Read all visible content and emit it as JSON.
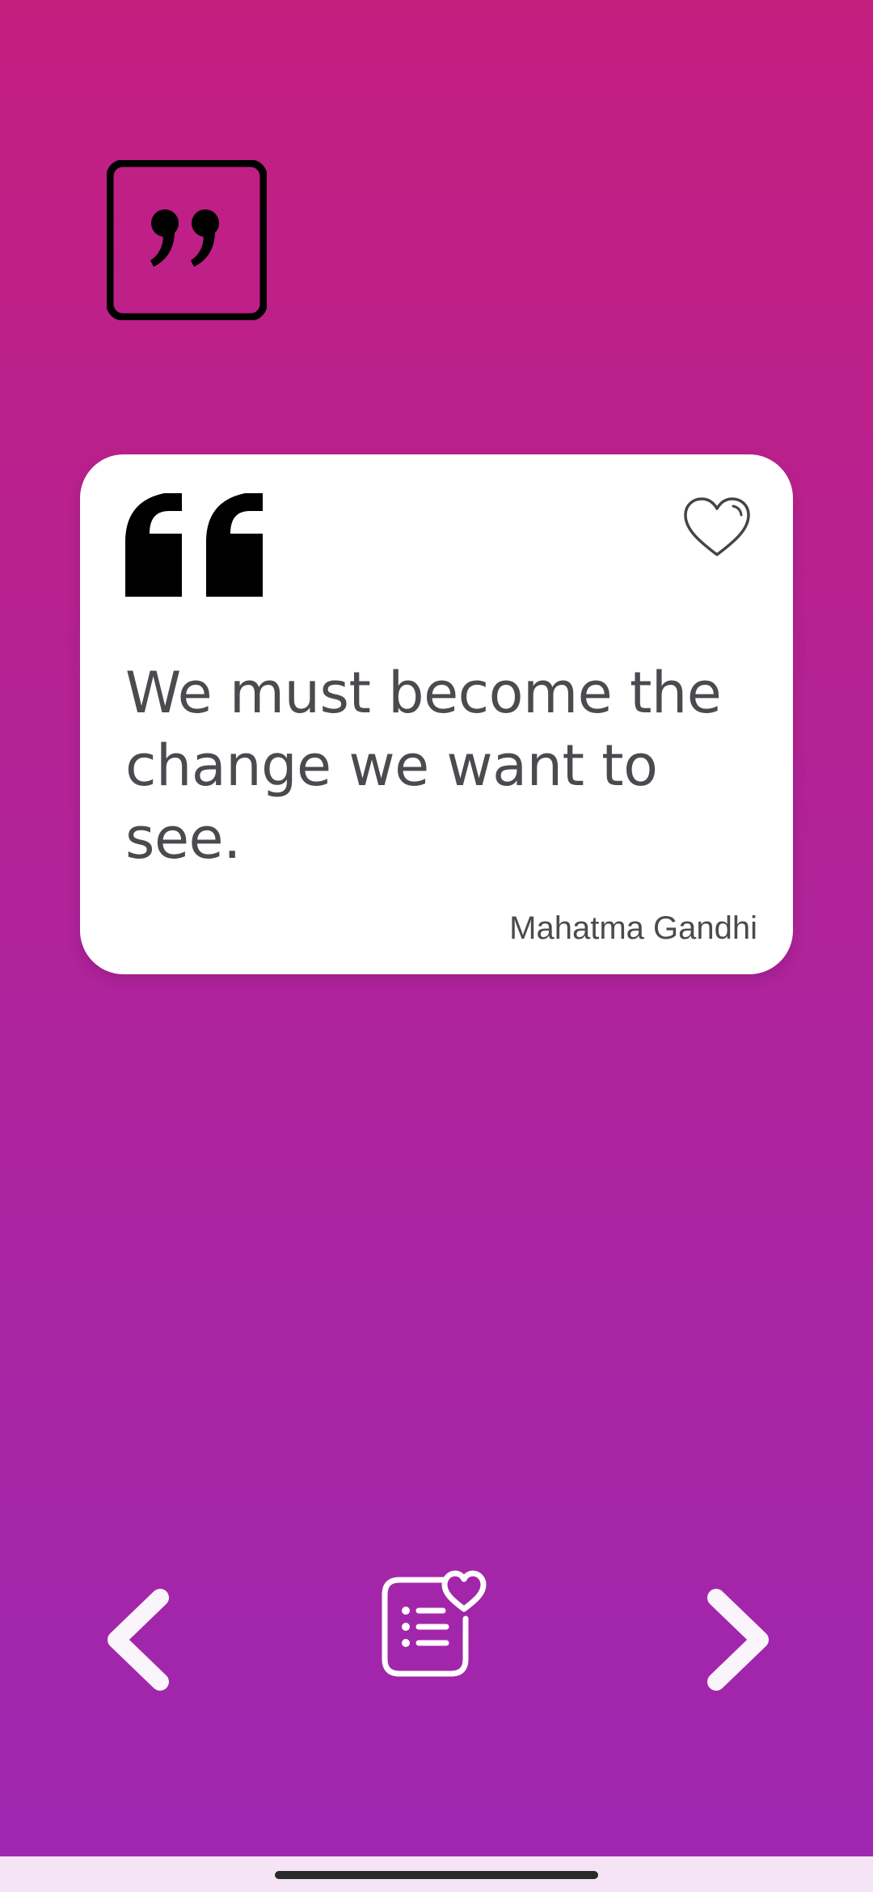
{
  "quote": {
    "text": "We must become the change we want to see.",
    "author": "Mahatma Gandhi"
  },
  "icons": {
    "logo": "quote-square-icon",
    "open_quote": "open-quote-icon",
    "favorite": "heart-outline-icon",
    "previous": "chevron-left-icon",
    "favorites_list": "list-heart-icon",
    "next": "chevron-right-icon"
  },
  "colors": {
    "gradient_top": "#c41e7f",
    "gradient_bottom": "#9e27b0",
    "card": "#ffffff",
    "text": "#4a4a4f",
    "nav_bar": "#f4e4f6"
  }
}
